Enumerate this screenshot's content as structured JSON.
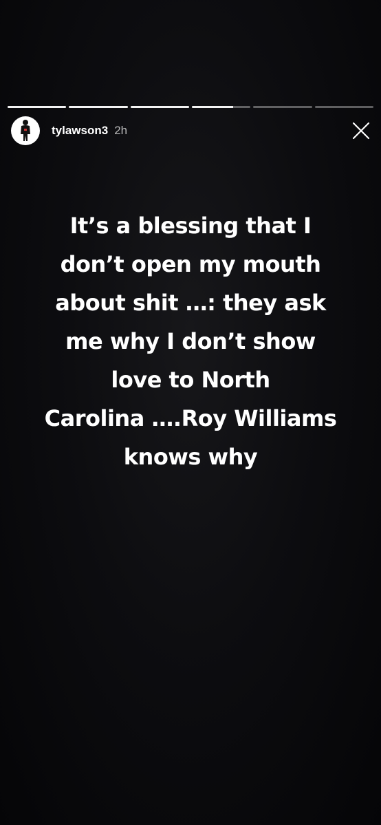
{
  "story": {
    "progress": [
      1,
      1,
      1,
      0.7,
      0,
      0
    ],
    "user": {
      "avatar_icon": "person-silhouette-icon",
      "username": "tylawson3",
      "timestamp": "2h"
    },
    "close_icon": "close-icon",
    "text_lines": [
      "It’s a blessing that I",
      "don’t open my mouth",
      "about shit …: they ask",
      "me why I don’t show",
      "love to North",
      "Carolina ….Roy Williams",
      "knows why"
    ]
  }
}
